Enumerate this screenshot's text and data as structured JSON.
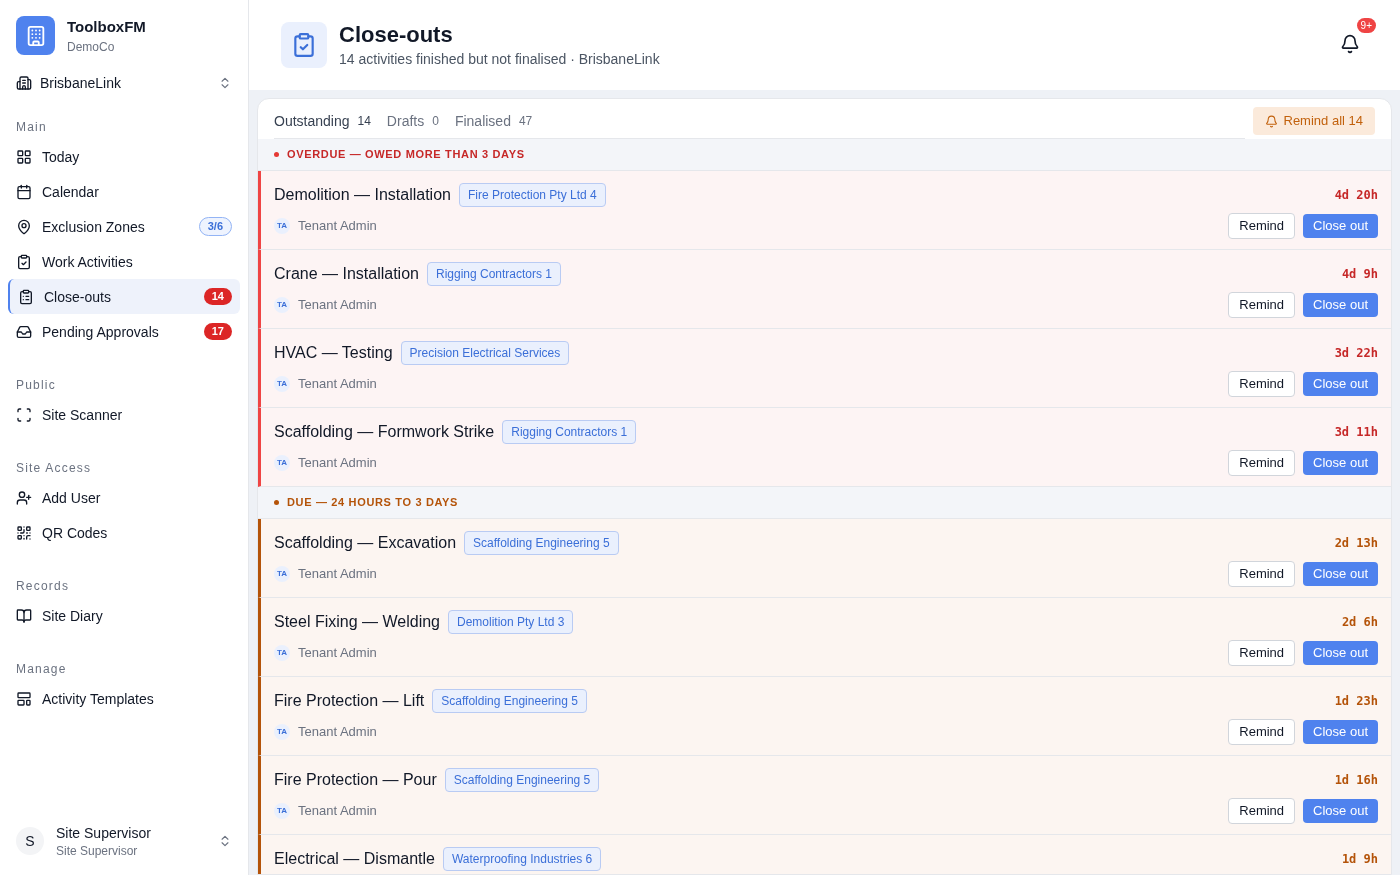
{
  "brand": {
    "name": "ToolboxFM",
    "org": "DemoCo"
  },
  "site": {
    "name": "BrisbaneLink"
  },
  "nav": [
    {
      "heading": "Main",
      "items": [
        {
          "label": "Today",
          "selected": false
        },
        {
          "label": "Calendar",
          "selected": false
        },
        {
          "label": "Exclusion Zones",
          "selected": false,
          "badge": {
            "text": "3/6",
            "kind": "info"
          }
        },
        {
          "label": "Work Activities",
          "selected": false
        },
        {
          "label": "Close-outs",
          "selected": true,
          "badge": {
            "text": "14",
            "kind": "alert"
          }
        },
        {
          "label": "Pending Approvals",
          "selected": false,
          "badge": {
            "text": "17",
            "kind": "alert"
          }
        }
      ]
    },
    {
      "heading": "Public",
      "items": [
        {
          "label": "Site Scanner",
          "selected": false
        }
      ]
    },
    {
      "heading": "Site Access",
      "items": [
        {
          "label": "Add User",
          "selected": false
        },
        {
          "label": "QR Codes",
          "selected": false
        }
      ]
    },
    {
      "heading": "Records",
      "items": [
        {
          "label": "Site Diary",
          "selected": false
        }
      ]
    },
    {
      "heading": "Manage",
      "items": [
        {
          "label": "Activity Templates",
          "selected": false
        }
      ]
    }
  ],
  "user": {
    "initial": "S",
    "name": "Site Supervisor",
    "role": "Site Supervisor"
  },
  "header": {
    "title": "Close-outs",
    "subtitle": "14 activities finished but not finalised · BrisbaneLink",
    "notifications": "9+"
  },
  "tabs": [
    {
      "label": "Outstanding",
      "count": "14",
      "selected": true
    },
    {
      "label": "Drafts",
      "count": "0",
      "selected": false
    },
    {
      "label": "Finalised",
      "count": "47",
      "selected": false
    }
  ],
  "remind_all": "Remind all 14",
  "groups": [
    {
      "kind": "overdue",
      "title": "OVERDUE — OWED MORE THAN 3 DAYS",
      "rows": [
        {
          "title": "Demolition — Installation",
          "tag": "Fire Protection Pty Ltd 4",
          "initials": "TA",
          "assignee": "Tenant Admin",
          "time": "4d 20h",
          "remind": "Remind",
          "close": "Close out"
        },
        {
          "title": "Crane — Installation",
          "tag": "Rigging Contractors 1",
          "initials": "TA",
          "assignee": "Tenant Admin",
          "time": "4d 9h",
          "remind": "Remind",
          "close": "Close out"
        },
        {
          "title": "HVAC — Testing",
          "tag": "Precision Electrical Services",
          "initials": "TA",
          "assignee": "Tenant Admin",
          "time": "3d 22h",
          "remind": "Remind",
          "close": "Close out"
        },
        {
          "title": "Scaffolding — Formwork Strike",
          "tag": "Rigging Contractors 1",
          "initials": "TA",
          "assignee": "Tenant Admin",
          "time": "3d 11h",
          "remind": "Remind",
          "close": "Close out"
        }
      ]
    },
    {
      "kind": "due",
      "title": "DUE — 24 HOURS TO 3 DAYS",
      "rows": [
        {
          "title": "Scaffolding — Excavation",
          "tag": "Scaffolding Engineering 5",
          "initials": "TA",
          "assignee": "Tenant Admin",
          "time": "2d 13h",
          "remind": "Remind",
          "close": "Close out"
        },
        {
          "title": "Steel Fixing — Welding",
          "tag": "Demolition Pty Ltd 3",
          "initials": "TA",
          "assignee": "Tenant Admin",
          "time": "2d 6h",
          "remind": "Remind",
          "close": "Close out"
        },
        {
          "title": "Fire Protection — Lift",
          "tag": "Scaffolding Engineering 5",
          "initials": "TA",
          "assignee": "Tenant Admin",
          "time": "1d 23h",
          "remind": "Remind",
          "close": "Close out"
        },
        {
          "title": "Fire Protection — Pour",
          "tag": "Scaffolding Engineering 5",
          "initials": "TA",
          "assignee": "Tenant Admin",
          "time": "1d 16h",
          "remind": "Remind",
          "close": "Close out"
        },
        {
          "title": "Electrical — Dismantle",
          "tag": "Waterproofing Industries 6",
          "time": "1d 9h"
        }
      ]
    }
  ]
}
